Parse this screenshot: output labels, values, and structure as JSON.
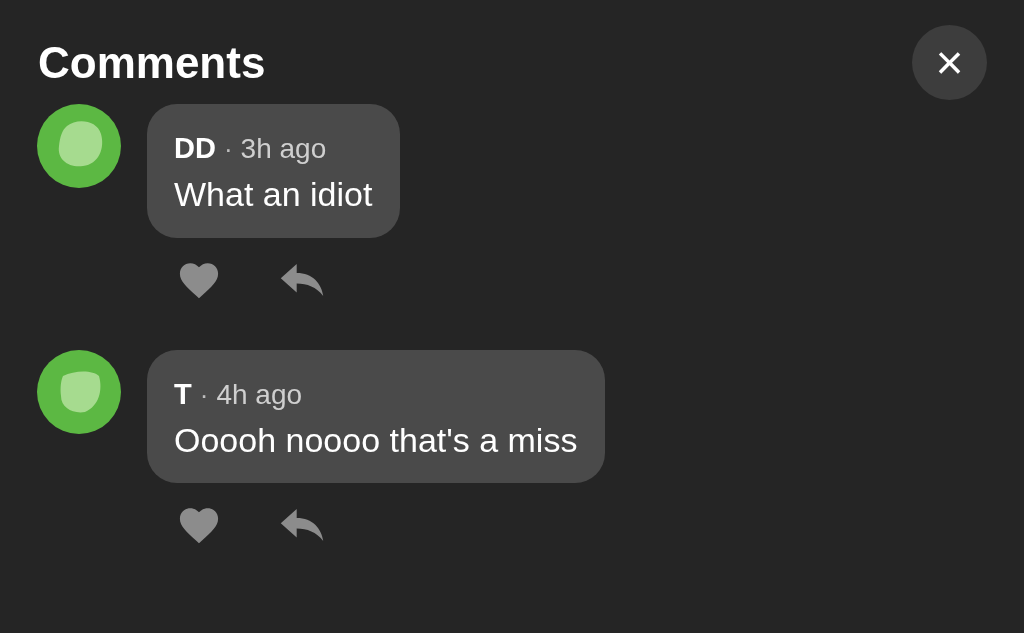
{
  "header": {
    "title": "Comments",
    "close_button": "×"
  },
  "comments": [
    {
      "author": "DD",
      "separator": "·",
      "time": "3h ago",
      "text": "What an idiot"
    },
    {
      "author": "T",
      "separator": "·",
      "time": "4h ago",
      "text": "Ooooh noooo that's a miss"
    }
  ]
}
